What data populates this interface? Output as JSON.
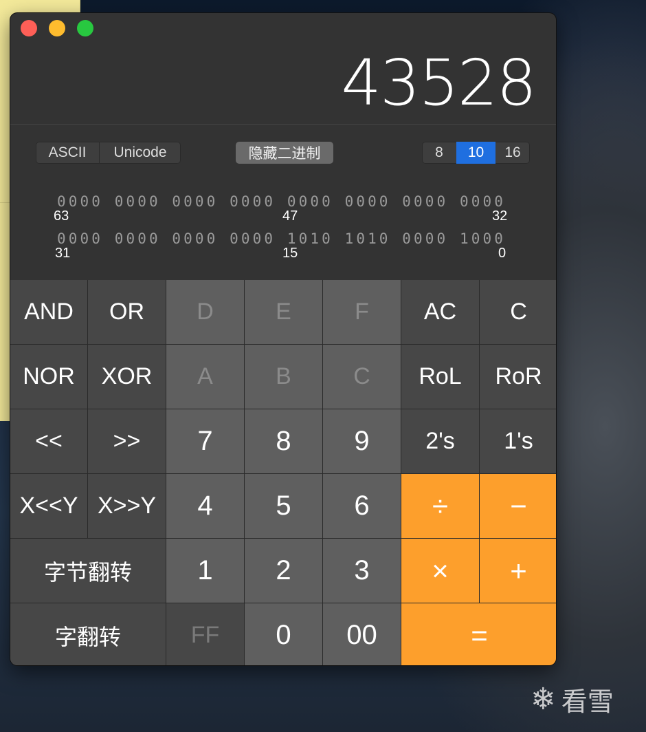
{
  "desktop": {
    "watermark_text": "看雪",
    "watermark_icon": "snowflake-icon"
  },
  "window": {
    "display_value": "43528",
    "encoding_options": [
      "ASCII",
      "Unicode"
    ],
    "hide_binary_label": "隐藏二进制",
    "base_options": [
      "8",
      "10",
      "16"
    ],
    "active_base": "10",
    "accent_color": "#fd9f2c",
    "selected_color": "#1f6fe0"
  },
  "binary": {
    "row1": "0000 0000 0000 0000 0000 0000 0000 0000",
    "row2": "0000 0000 0000 0000 1010 1010 0000 1000",
    "row1_labels": [
      "63",
      "47",
      "32"
    ],
    "row2_labels": [
      "31",
      "15",
      "0"
    ]
  },
  "keys": {
    "and": "AND",
    "or": "OR",
    "d": "D",
    "e": "E",
    "f": "F",
    "ac": "AC",
    "c_clear": "C",
    "nor": "NOR",
    "xor": "XOR",
    "a": "A",
    "b": "B",
    "c_hex": "C",
    "rol": "RoL",
    "ror": "RoR",
    "shl": "<<",
    "shr": ">>",
    "n7": "7",
    "n8": "8",
    "n9": "9",
    "twos": "2's",
    "ones": "1's",
    "xshly": "X<<Y",
    "xshry": "X>>Y",
    "n4": "4",
    "n5": "5",
    "n6": "6",
    "div": "÷",
    "minus": "−",
    "byte_flip": "字节翻转",
    "n1": "1",
    "n2": "2",
    "n3": "3",
    "mul": "×",
    "plus": "+",
    "word_flip": "字翻转",
    "ff": "FF",
    "n0": "0",
    "n00": "00",
    "eq": "="
  }
}
